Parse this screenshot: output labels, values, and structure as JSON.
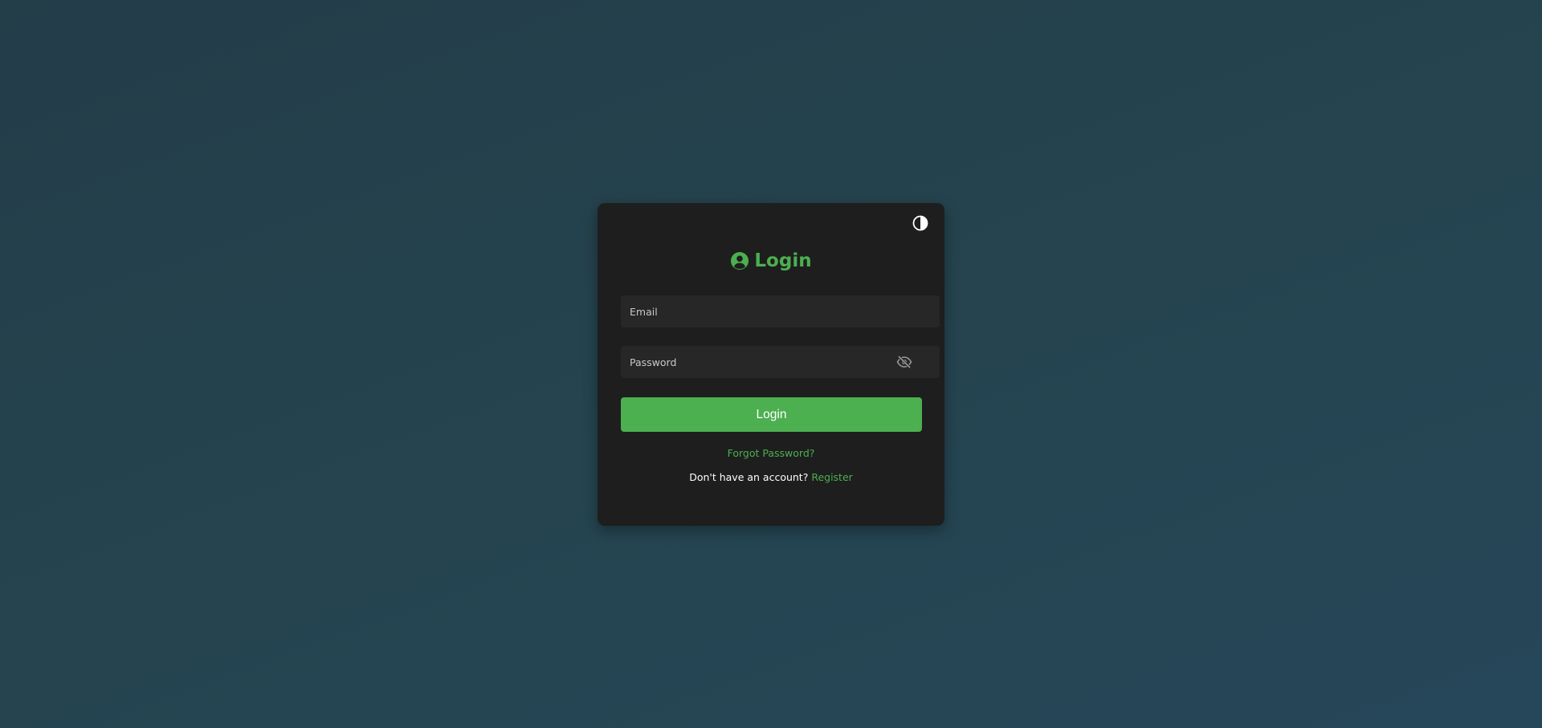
{
  "colors": {
    "accent": "#4caf50",
    "card_background": "#1e1e1e",
    "input_background": "#272727",
    "page_background": "#25444f"
  },
  "card": {
    "theme_toggle_icon": "half-circle-contrast-icon",
    "title_icon": "user-circle-icon",
    "title": "Login"
  },
  "form": {
    "email": {
      "placeholder": "Email",
      "value": ""
    },
    "password": {
      "placeholder": "Password",
      "value": "",
      "toggle_icon": "eye-slash-icon"
    },
    "submit_label": "Login"
  },
  "links": {
    "forgot_password": "Forgot Password?",
    "no_account_text": "Don't have an account?",
    "register": "Register"
  }
}
